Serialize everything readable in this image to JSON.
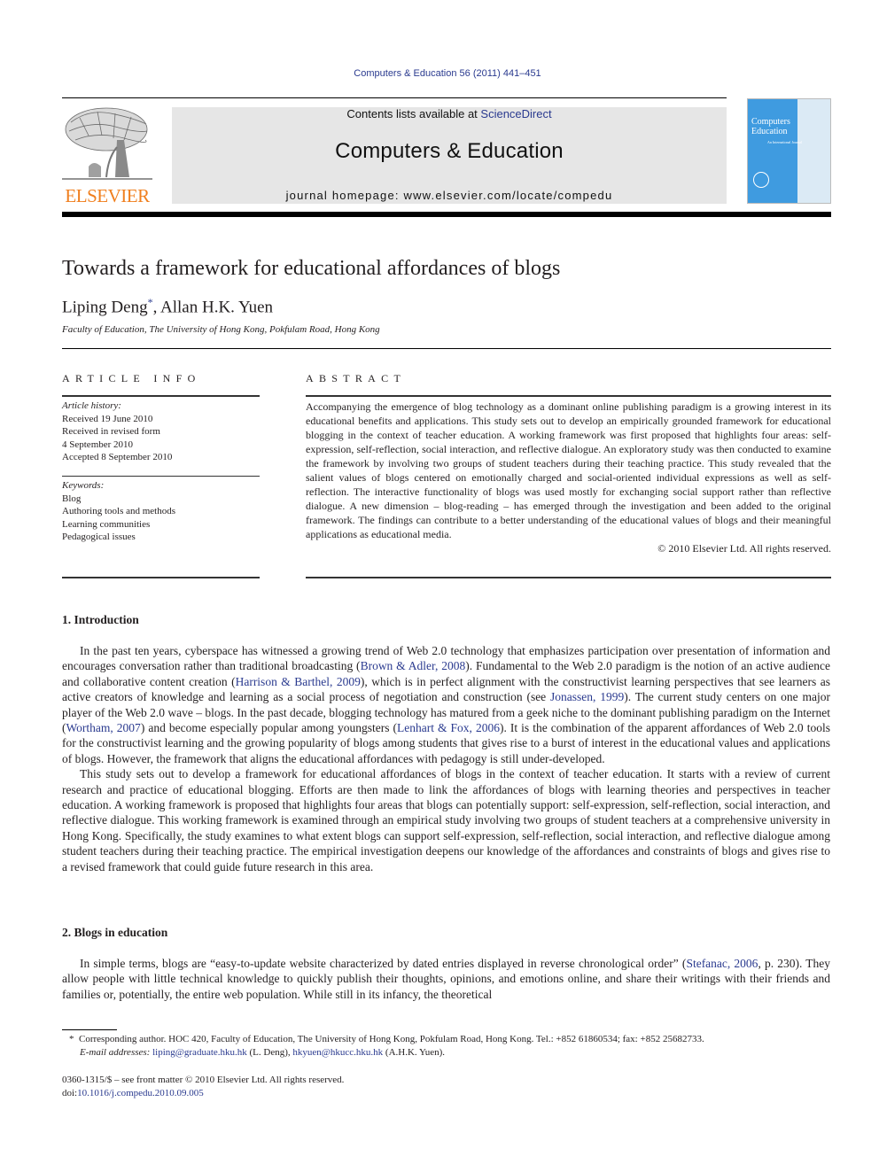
{
  "header": {
    "citation": "Computers & Education 56 (2011) 441–451",
    "contents_prefix": "Contents lists available at ",
    "contents_link": "ScienceDirect",
    "journal_title": "Computers & Education",
    "homepage_prefix": "journal homepage: ",
    "homepage_url": "www.elsevier.com/locate/compedu",
    "publisher_logo_text": "ELSEVIER",
    "cover": {
      "title_line1": "Computers",
      "title_line2": "Education",
      "subtitle": "An International Journal"
    },
    "colors": {
      "link": "#2a3a8f",
      "elsevier_orange": "#f07f1e",
      "masthead_bg": "#e6e6e6",
      "cover_blue": "#3f9be0"
    }
  },
  "article": {
    "title": "Towards a framework for educational affordances of blogs",
    "authors": [
      {
        "name": "Liping Deng",
        "mark": "*"
      },
      {
        "name": "Allan H.K. Yuen",
        "mark": ""
      }
    ],
    "author_separator": ", ",
    "affiliation": "Faculty of Education, The University of Hong Kong, Pokfulam Road, Hong Kong"
  },
  "article_info": {
    "heading": "ARTICLE INFO",
    "history_label": "Article history:",
    "history": [
      "Received 19 June 2010",
      "Received in revised form",
      "4 September 2010",
      "Accepted 8 September 2010"
    ],
    "keywords_label": "Keywords:",
    "keywords": [
      "Blog",
      "Authoring tools and methods",
      "Learning communities",
      "Pedagogical issues"
    ]
  },
  "abstract": {
    "heading": "ABSTRACT",
    "text": "Accompanying the emergence of blog technology as a dominant online publishing paradigm is a growing interest in its educational benefits and applications. This study sets out to develop an empirically grounded framework for educational blogging in the context of teacher education. A working framework was first proposed that highlights four areas: self-expression, self-reflection, social interaction, and reflective dialogue. An exploratory study was then conducted to examine the framework by involving two groups of student teachers during their teaching practice. This study revealed that the salient values of blogs centered on emotionally charged and social-oriented individual expressions as well as self-reflection. The interactive functionality of blogs was used mostly for exchanging social support rather than reflective dialogue. A new dimension – blog-reading – has emerged through the investigation and been added to the original framework. The findings can contribute to a better understanding of the educational values of blogs and their meaningful applications as educational media.",
    "copyright": "© 2010 Elsevier Ltd. All rights reserved."
  },
  "sections": [
    {
      "heading": "1.  Introduction",
      "paragraphs": [
        [
          {
            "t": "In the past ten years, cyberspace has witnessed a growing trend of Web 2.0 technology that emphasizes participation over presentation of information and encourages conversation rather than traditional broadcasting ("
          },
          {
            "link": "Brown & Adler, 2008"
          },
          {
            "t": "). Fundamental to the Web 2.0 paradigm is the notion of an active audience and collaborative content creation ("
          },
          {
            "link": "Harrison & Barthel, 2009"
          },
          {
            "t": "), which is in perfect alignment with the constructivist learning perspectives that see learners as active creators of knowledge and learning as a social process of negotiation and construction (see "
          },
          {
            "link": "Jonassen, 1999"
          },
          {
            "t": "). The current study centers on one major player of the Web 2.0 wave – blogs. In the past decade, blogging technology has matured from a geek niche to the dominant publishing paradigm on the Internet ("
          },
          {
            "link": "Wortham, 2007"
          },
          {
            "t": ") and become especially popular among youngsters ("
          },
          {
            "link": "Lenhart & Fox, 2006"
          },
          {
            "t": "). It is the combination of the apparent affordances of Web 2.0 tools for the constructivist learning and the growing popularity of blogs among students that gives rise to a burst of interest in the educational values and applications of blogs. However, the framework that aligns the educational affordances with pedagogy is still under-developed."
          }
        ],
        [
          {
            "t": "This study sets out to develop a framework for educational affordances of blogs in the context of teacher education. It starts with a review of current research and practice of educational blogging. Efforts are then made to link the affordances of blogs with learning theories and perspectives in teacher education. A working framework is proposed that highlights four areas that blogs can potentially support: self-expression, self-reflection, social interaction, and reflective dialogue. This working framework is examined through an empirical study involving two groups of student teachers at a comprehensive university in Hong Kong. Specifically, the study examines to what extent blogs can support self-expression, self-reflection, social interaction, and reflective dialogue among student teachers during their teaching practice. The empirical investigation deepens our knowledge of the affordances and constraints of blogs and gives rise to a revised framework that could guide future research in this area."
          }
        ]
      ]
    },
    {
      "heading": "2.  Blogs in education",
      "paragraphs": [
        [
          {
            "t": "In simple terms, blogs are “easy-to-update website characterized by dated entries displayed in reverse chronological order” ("
          },
          {
            "link": "Stefanac, 2006"
          },
          {
            "t": ", p. 230). They allow people with little technical knowledge to quickly publish their thoughts, opinions, and emotions online, and share their writings with their friends and families or, potentially, the entire web population. While still in its infancy, the theoretical"
          }
        ]
      ]
    }
  ],
  "footnote": {
    "mark": "*",
    "corresponding": "Corresponding author. HOC 420, Faculty of Education, The University of Hong Kong, Pokfulam Road, Hong Kong. Tel.: +852 61860534; fax: +852 25682733.",
    "email_label": "E-mail addresses:",
    "emails": [
      {
        "address": "liping@graduate.hku.hk",
        "owner": " (L. Deng), "
      },
      {
        "address": "hkyuen@hkucc.hku.hk",
        "owner": " (A.H.K. Yuen)."
      }
    ]
  },
  "front_matter": {
    "issn_line": "0360-1315/$ – see front matter © 2010 Elsevier Ltd. All rights reserved.",
    "doi_prefix": "doi:",
    "doi": "10.1016/j.compedu.2010.09.005"
  }
}
